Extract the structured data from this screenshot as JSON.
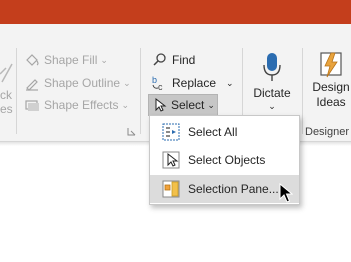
{
  "ribbon": {
    "cut_left_texts": [
      "ck",
      "es"
    ],
    "shape_fill": "Shape Fill",
    "shape_outline": "Shape Outline",
    "shape_effects": "Shape Effects",
    "caret": "⌄",
    "find": "Find",
    "replace": "Replace",
    "select": "Select",
    "dictate": "Dictate",
    "dictate_caret": "⌄",
    "design_ideas_line1": "Design",
    "design_ideas_line2": "Ideas",
    "designer_group": "Designer"
  },
  "select_menu": {
    "items": [
      {
        "label": "Select All",
        "icon": "select-all-icon"
      },
      {
        "label": "Select Objects",
        "icon": "select-objects-icon"
      },
      {
        "label": "Selection Pane...",
        "icon": "selection-pane-icon"
      }
    ]
  },
  "colors": {
    "title_bar": "#c43e1c",
    "ribbon": "#f3f3f3",
    "hover": "#dcdcdc",
    "design_ideas_accent": "#e8a33d"
  }
}
